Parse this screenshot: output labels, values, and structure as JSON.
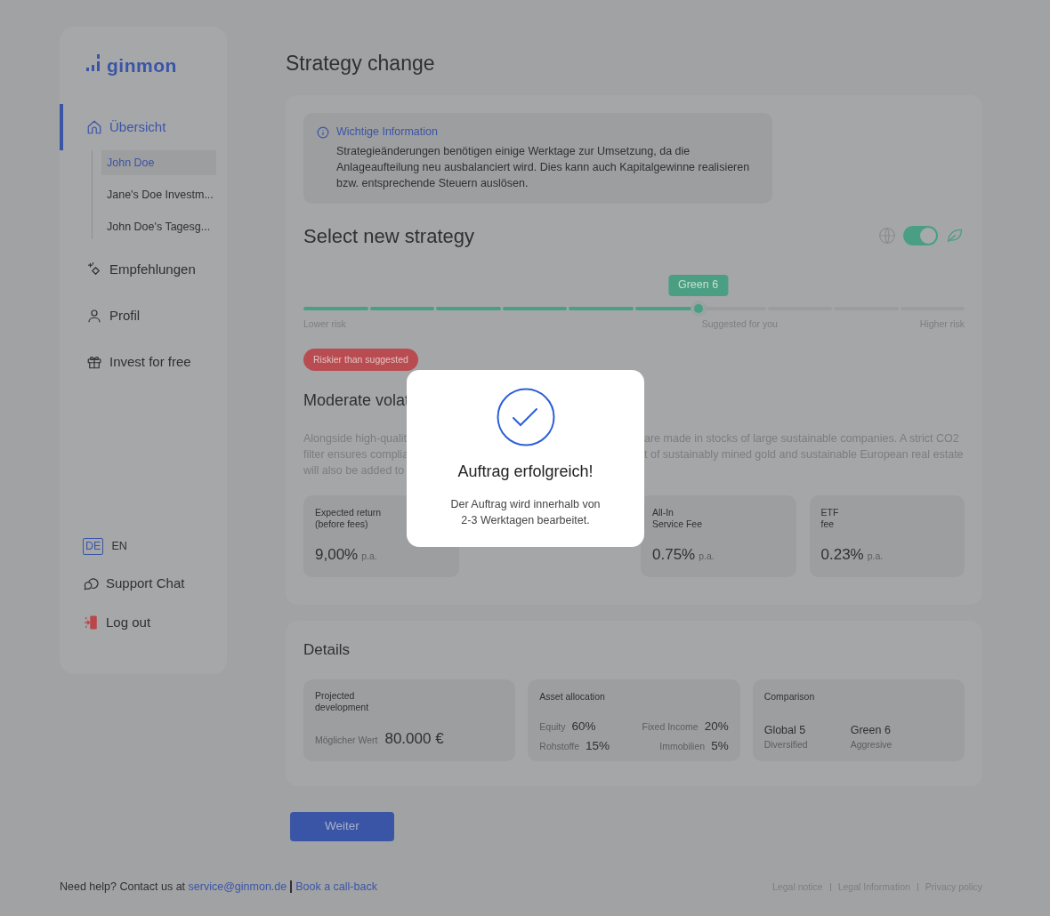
{
  "logo": {
    "text": "ginmon"
  },
  "sidebar": {
    "nav": [
      {
        "label": "Übersicht",
        "selected": true,
        "children": [
          {
            "label": "John Doe",
            "selected": true
          },
          {
            "label": "Jane's Doe Investm...",
            "selected": false
          },
          {
            "label": "John Doe's Tagesg...",
            "selected": false
          }
        ]
      },
      {
        "label": "Empfehlungen",
        "selected": false
      },
      {
        "label": "Profil",
        "selected": false
      },
      {
        "label": "Invest for free",
        "selected": false
      }
    ],
    "languages": [
      {
        "label": "DE",
        "selected": true
      },
      {
        "label": "EN",
        "selected": false
      }
    ],
    "bottom_links": [
      {
        "label": "Support Chat"
      },
      {
        "label": "Log out"
      }
    ]
  },
  "page": {
    "title": "Strategy change"
  },
  "info": {
    "title": "Wichtige Information",
    "text": "Strategieänderungen benötigen einige Werktage zur Umsetzung, da die Anlageaufteilung neu ausbalanciert wird. Dies kann auch Kapitalgewinne realisieren bzw. entsprechende Steuern auslösen."
  },
  "strategy": {
    "title": "Select new strategy",
    "green_toggle": {
      "on": true
    },
    "slider": {
      "level": 0.6,
      "badge": "Green 6",
      "labels": [
        "Lower risk",
        "Suggested for you",
        "Higher risk"
      ]
    },
    "warning": "Riskier than suggested",
    "heading": "Moderate volat",
    "description_lines": [
      {
        "left": "Alongside high-qualit",
        "right": "are made in stocks of large sustainable companies. A strict CO2"
      },
      {
        "left": "filter ensures complia",
        "right": "t of sustainably mined gold and sustainable European real estate"
      },
      {
        "left": "will also be added to"
      }
    ],
    "metrics": [
      {
        "label": "Expected return\n(before fees)",
        "value": "9,00%",
        "unit": "p.a."
      },
      {
        "label": "All-In\nService Fee",
        "value": "0.75%",
        "unit": "p.a."
      },
      {
        "label": "ETF\nfee",
        "value": "0.23%",
        "unit": "p.a."
      }
    ]
  },
  "details": {
    "title": "Details",
    "projected": {
      "title": "Projected\ndevelopment",
      "label": "Möglicher Wert",
      "value": "80.000 €"
    },
    "allocation": {
      "title": "Asset allocation",
      "items": [
        {
          "label": "Equity",
          "value": "60%"
        },
        {
          "label": "Fixed Income",
          "value": "20%"
        },
        {
          "label": "Rohstoffe",
          "value": "15%"
        },
        {
          "label": "Immobilien",
          "value": "5%"
        }
      ]
    },
    "comparison": {
      "title": "Comparison",
      "items": [
        {
          "name": "Global 5",
          "sub": "Diversified"
        },
        {
          "name": "Green 6",
          "sub": "Aggresive"
        }
      ]
    }
  },
  "continue_button": "Weiter",
  "footer": {
    "help": "Need help? Contact us at ",
    "email": "service@ginmon.de",
    "callback": "Book a call-back",
    "legal": [
      "Legal notice",
      "Legal Information",
      "Privacy policy"
    ]
  },
  "modal": {
    "title": "Auftrag erfolgreich!",
    "text": "Der Auftrag wird innerhalb von\n2-3 Werktagen bearbeitet."
  }
}
